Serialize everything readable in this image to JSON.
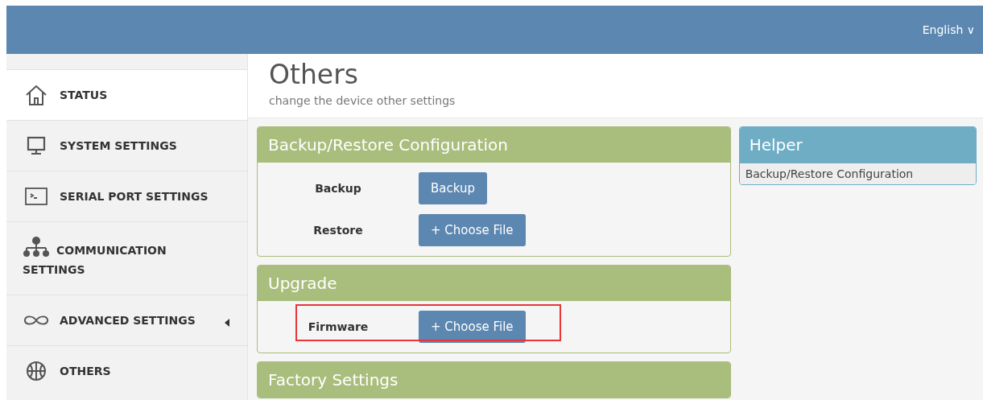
{
  "top_bar": {
    "language": "English ∨"
  },
  "sidebar": {
    "items": [
      {
        "label": "STATUS",
        "selected": true
      },
      {
        "label": "SYSTEM SETTINGS",
        "selected": false
      },
      {
        "label": "SERIAL PORT SETTINGS",
        "selected": false
      },
      {
        "label": "COMMUNICATION SETTINGS",
        "selected": false
      },
      {
        "label": "ADVANCED SETTINGS",
        "selected": false,
        "expandable": true
      },
      {
        "label": "OTHERS",
        "selected": false
      }
    ]
  },
  "page": {
    "title": "Others",
    "subtitle": "change the device other settings"
  },
  "panels": [
    {
      "title": "Backup/Restore Configuration",
      "rows": [
        {
          "label": "Backup",
          "button": "Backup",
          "highlighted": false
        },
        {
          "label": "Restore",
          "button": "+ Choose File",
          "highlighted": false
        }
      ]
    },
    {
      "title": "Upgrade",
      "rows": [
        {
          "label": "Firmware",
          "button": "+ Choose File",
          "highlighted": true
        }
      ]
    },
    {
      "title": "Factory Settings"
    }
  ],
  "helper": {
    "title": "Helper",
    "text": "Backup/Restore Configuration"
  }
}
